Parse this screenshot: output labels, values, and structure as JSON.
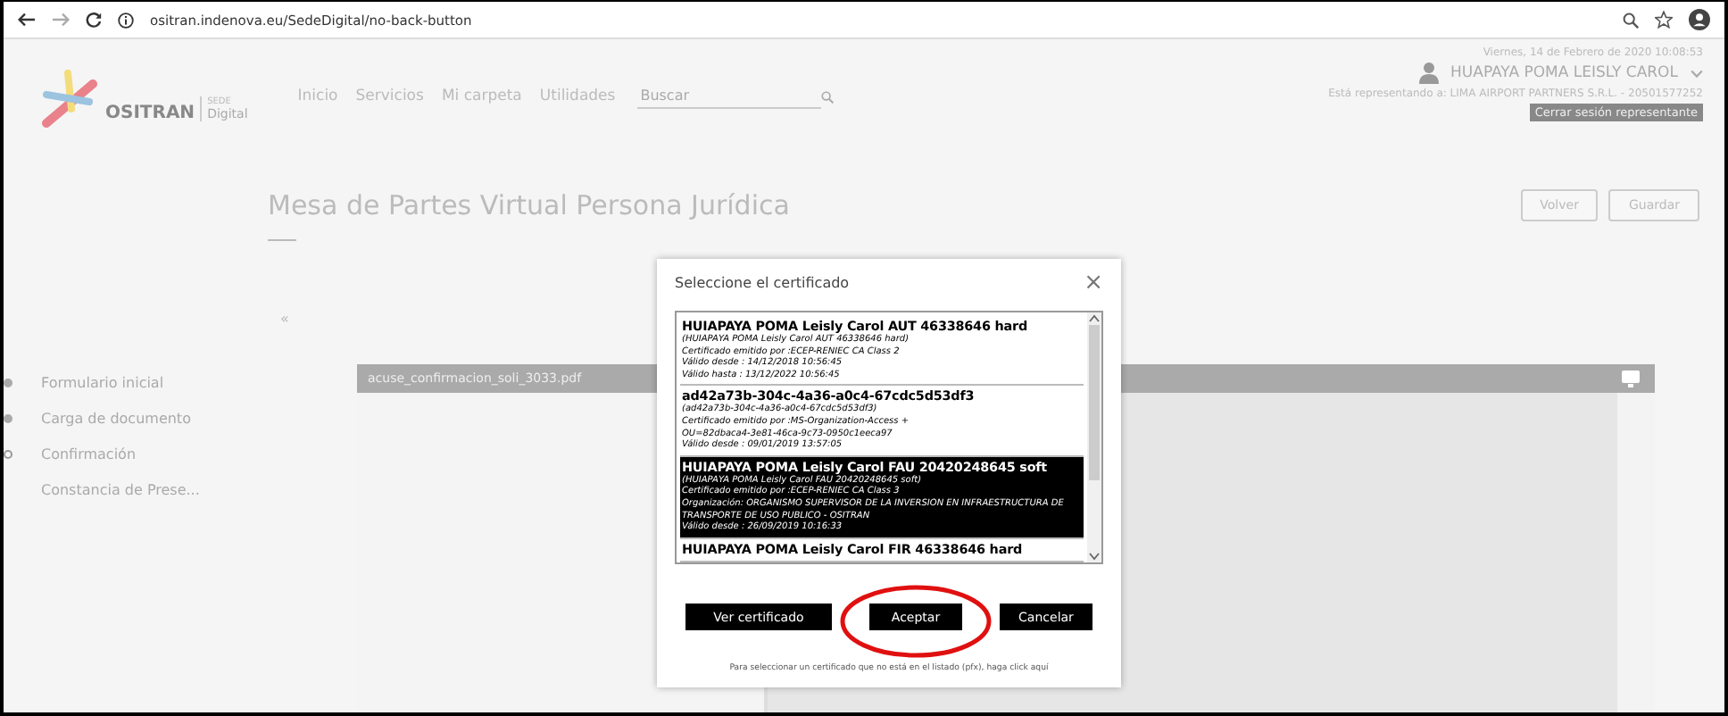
{
  "browser": {
    "url": "ositran.indenova.eu/SedeDigital/no-back-button"
  },
  "header": {
    "logo": {
      "brand": "OSITRAN",
      "sub_top": "SEDE",
      "sub": "Digital"
    },
    "nav": [
      "Inicio",
      "Servicios",
      "Mi carpeta",
      "Utilidades"
    ],
    "search": {
      "placeholder": "Buscar"
    },
    "date": "Viernes, 14 de Febrero de 2020 10:08:53",
    "user": "HUAPAYA POMA LEISLY CAROL",
    "representing": "Está representando a: LIMA AIRPORT PARTNERS S.R.L. - 20501577252",
    "close_session": "Cerrar sesión representante"
  },
  "page": {
    "title": "Mesa de Partes Virtual Persona Jurídica",
    "buttons": [
      "Volver",
      "Guardar"
    ],
    "collapse": "«"
  },
  "steps": [
    {
      "label": "Formulario inicial",
      "completed": true,
      "current": false
    },
    {
      "label": "Carga de documento",
      "completed": true,
      "current": false
    },
    {
      "label": "Confirmación",
      "completed": false,
      "current": true
    },
    {
      "label": "Constancia de Prese...",
      "completed": false,
      "current": false
    }
  ],
  "viewer": {
    "file": "acuse_confirmacion_soli_3033.pdf"
  },
  "dialog": {
    "title": "Seleccione el certificado",
    "close": "×",
    "certificates": [
      {
        "name": "HUIAPAYA POMA Leisly Carol AUT 46338646 hard",
        "selected": false,
        "lines": [
          "(HUIAPAYA POMA Leisly Carol AUT 46338646 hard)",
          "Certificado emitido por :ECEP-RENIEC CA Class 2",
          "Válido desde : 14/12/2018 10:56:45",
          "Válido hasta : 13/12/2022 10:56:45"
        ]
      },
      {
        "name": "ad42a73b-304c-4a36-a0c4-67cdc5d53df3",
        "selected": false,
        "lines": [
          "(ad42a73b-304c-4a36-a0c4-67cdc5d53df3)",
          "Certificado emitido por :MS-Organization-Access +",
          "OU=82dbaca4-3e81-46ca-9c73-0950c1eeca97",
          "Válido desde : 09/01/2019 13:57:05"
        ]
      },
      {
        "name": "HUIAPAYA POMA Leisly Carol FAU 20420248645 soft",
        "selected": true,
        "lines": [
          "(HUIAPAYA POMA Leisly Carol FAU 20420248645 soft)",
          "Certificado emitido por :ECEP-RENIEC CA Class 3",
          "Organización: ORGANISMO SUPERVISOR DE LA INVERSION EN INFRAESTRUCTURA DE TRANSPORTE DE USO PUBLICO - OSITRAN",
          "Válido desde : 26/09/2019 10:16:33"
        ]
      },
      {
        "name": "HUIAPAYA POMA Leisly Carol FIR 46338646 hard",
        "selected": false
      }
    ],
    "buttons": [
      "Ver certificado",
      "Aceptar",
      "Cancelar"
    ],
    "footer": "Para seleccionar un certificado que no está en el listado (pfx), haga click aquí"
  }
}
